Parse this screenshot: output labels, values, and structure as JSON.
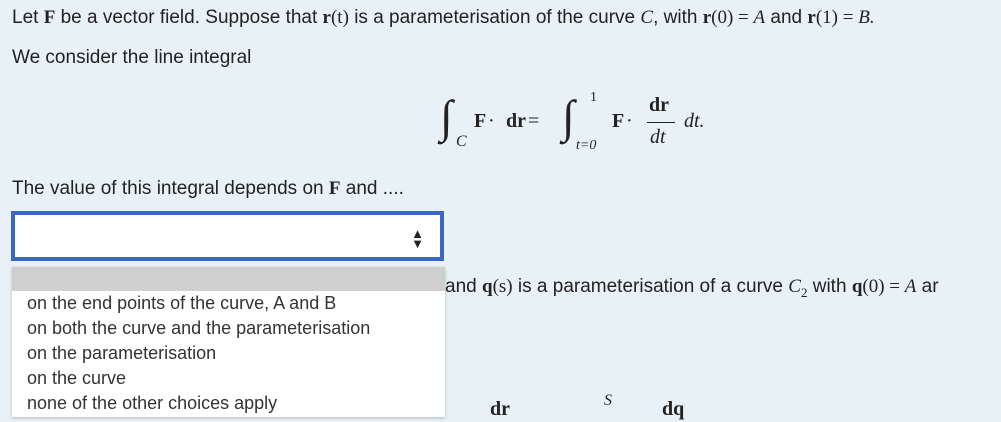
{
  "intro": {
    "t1": "Let ",
    "F": "F",
    "t2": " be a vector field.  Suppose that ",
    "r": "r",
    "t_paren": "(t)",
    "t3": " is a parameterisation of the curve ",
    "C": "C",
    "t4": ", with ",
    "r0": "r",
    "r0_arg": "(0) = ",
    "A": "A",
    "t5": " and ",
    "r1": "r",
    "r1_arg": "(1) = ",
    "B": "B."
  },
  "consider": "We consider the line integral",
  "equation": {
    "int1": "∫",
    "sub_C": "C",
    "F1": "F",
    "dot_dr": " · ",
    "dr": "dr",
    "eq": " = ",
    "int2": "∫",
    "upper": "1",
    "lower": "t=0",
    "F2": "F",
    "dot2": " · ",
    "num": "dr",
    "den": "dt",
    "dt": "dt."
  },
  "depends": {
    "text": "The value of this integral depends on ",
    "F": "F",
    "tail": " and ...."
  },
  "select": {
    "selected": "",
    "options": [
      "on the end points of the curve, A and B",
      "on both the curve and the parameterisation",
      "on the parameterisation",
      "on the curve",
      "none of the other choices apply"
    ]
  },
  "second": {
    "t1": "and ",
    "q": "q",
    "s_paren": "(s)",
    "t2": " is a parameterisation of a curve ",
    "C2": "C",
    "sub2": "2",
    "t3": " with ",
    "q0": "q",
    "q0_arg": "(0) = ",
    "A": "A",
    "tail": " ar"
  },
  "bottom": {
    "dr": "dr",
    "S": "S",
    "dq": "dq"
  }
}
